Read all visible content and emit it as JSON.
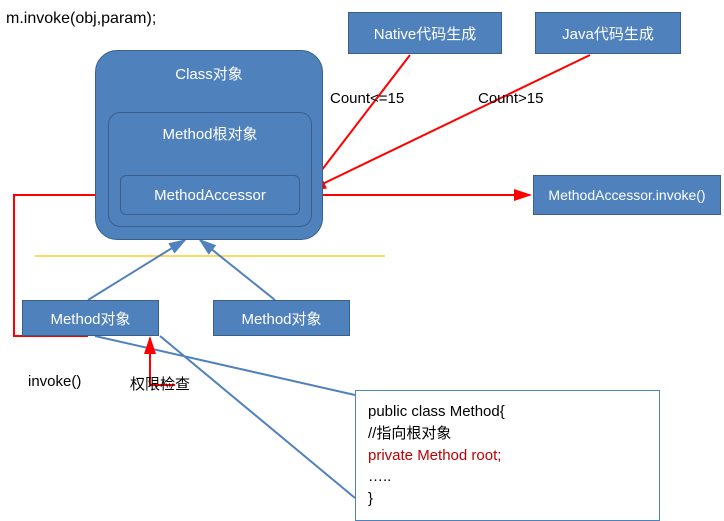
{
  "top_code": "m.invoke(obj,param);",
  "class_obj": "Class对象",
  "method_root": "Method根对象",
  "method_accessor": "MethodAccessor",
  "native_gen": "Native代码生成",
  "java_gen": "Java代码生成",
  "count_le": "Count<=15",
  "count_gt": "Count>15",
  "accessor_invoke": "MethodAccessor.invoke()",
  "method_obj1": "Method对象",
  "method_obj2": "Method对象",
  "invoke_label": "invoke()",
  "perm_check": "权限检查",
  "cls_head": "public class Method{",
  "cls_comment": " //指向根对象",
  "cls_field": " private Method   root;",
  "cls_dots": " …..",
  "cls_close": "}"
}
